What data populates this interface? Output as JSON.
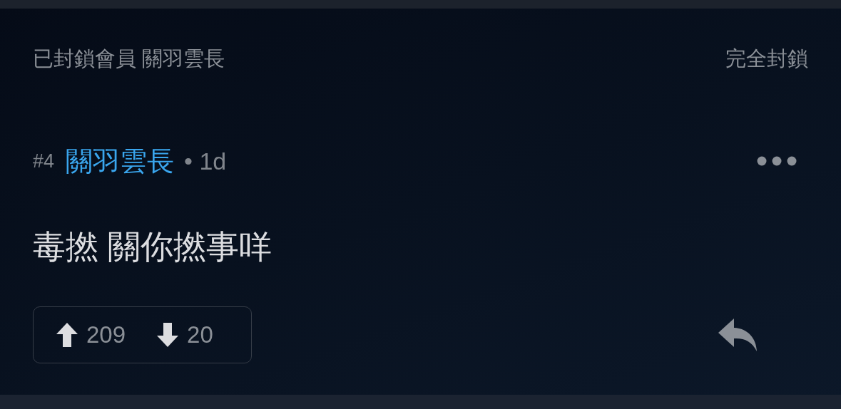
{
  "blocked_notice": {
    "label": "已封鎖會員 關羽雲長",
    "action": "完全封鎖"
  },
  "post": {
    "number": "#4",
    "author": "關羽雲長",
    "age": "• 1d",
    "body": "毒撚 關你撚事咩",
    "upvotes": "209",
    "downvotes": "20"
  }
}
